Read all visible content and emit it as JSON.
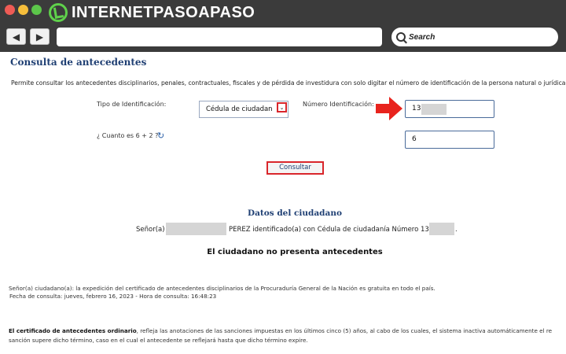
{
  "browser": {
    "logo_text": "INTERNETPASOAPASO",
    "search_label": "Search",
    "back_glyph": "◀",
    "forward_glyph": "▶"
  },
  "page": {
    "title": "Consulta de antecedentes",
    "description": "Permite consultar los antecedentes disciplinarios, penales, contractuales, fiscales y de pérdida de investidura con solo digitar el número de identificación de la persona natural o jurídica."
  },
  "form": {
    "id_type_label": "Tipo de Identificación:",
    "id_type_value": "Cédula de ciudadan",
    "id_number_label": "Número Identificación:",
    "id_number_value": "13",
    "captcha_label": "¿ Cuanto es 6 + 2 ?",
    "captcha_value": "6",
    "submit_label": "Consultar"
  },
  "citizen": {
    "section_title": "Datos del ciudadano",
    "salutation": "Señor(a)",
    "surname_and_id_text": "PEREZ identificado(a) con Cédula de ciudadanía Número 13",
    "trailing_period": ".",
    "result": "El ciudadano no presenta antecedentes"
  },
  "notice": {
    "line1": "Señor(a) ciudadano(a): la expedición del certificado de antecedentes disciplinarios de la Procuraduría General de la Nación es gratuita en todo el país.",
    "line2": "Fecha de consulta: jueves, febrero 16, 2023 - Hora de consulta: 16:48:23"
  },
  "footer": {
    "bold_intro": "El certificado de antecedentes ordinario",
    "line1_rest": ", refleja las anotaciones de las sanciones impuestas en los últimos cinco (5) años, al cabo de los cuales, el sistema inactiva automáticamente el re",
    "line2": "sanción supere dicho término, caso en el cual el antecedente se reflejará hasta que dicho término expire."
  },
  "colors": {
    "accent_blue": "#1f3f73",
    "highlight_red": "#d9262b",
    "logo_green": "#5fd14b"
  }
}
